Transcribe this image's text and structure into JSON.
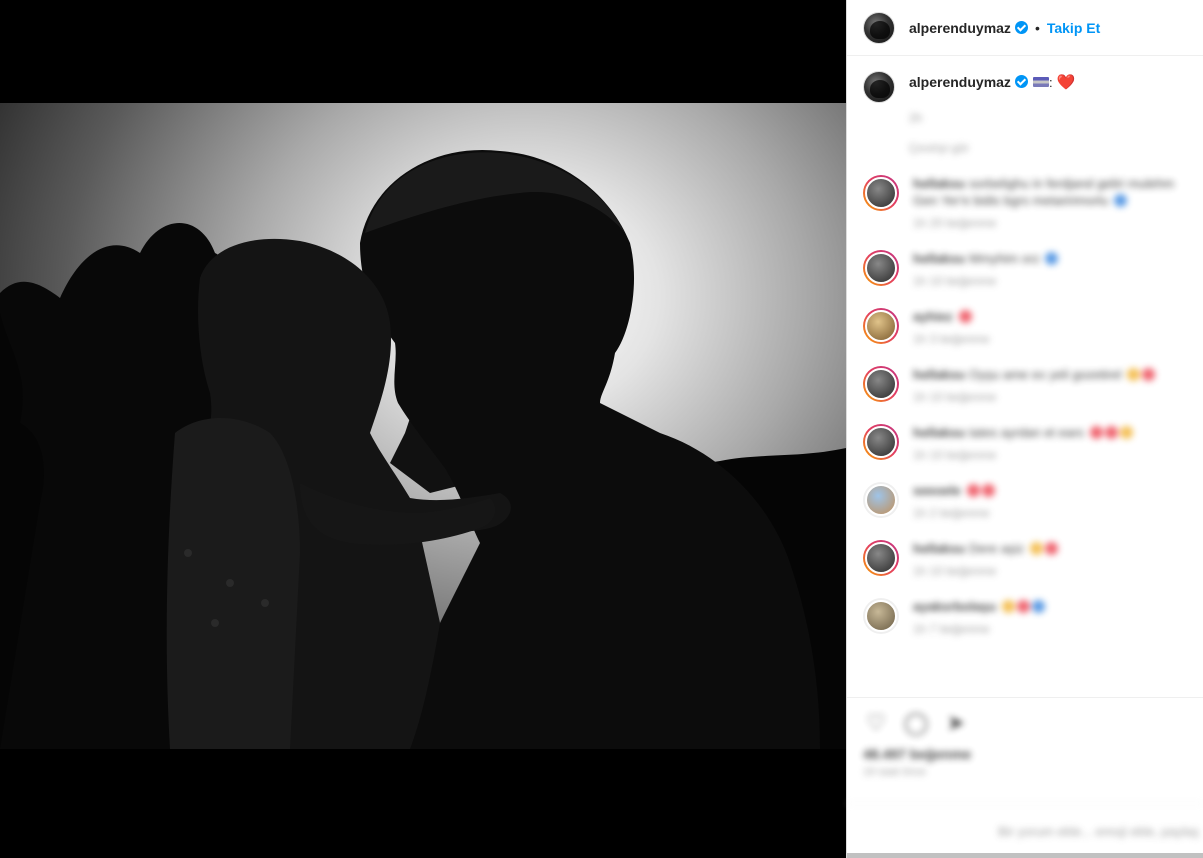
{
  "post": {
    "username": "alperenduymaz",
    "follow_label": "Takip Et",
    "separator": "•"
  },
  "caption": {
    "username": "alperenduymaz",
    "text_colon": ":",
    "emoji": "❤️",
    "edited": "2h",
    "see_translation": "Çeviriyi gör"
  },
  "comments": [
    {
      "user": "hellaksu",
      "text": "sorbelighu in ferdjand geliri mulehm Gen Yer'e bidis bgrs metaririmorlu",
      "meta": "1h   20 beğenme"
    },
    {
      "user": "hellaksu",
      "text": "Mmyhim orz",
      "meta": "1h   10 beğenme"
    },
    {
      "user": "ayhiez",
      "text": "",
      "meta": "1h   3 beğenme"
    },
    {
      "user": "hellaksu",
      "text": "Oyşu ame ex yeli gozetirel",
      "meta": "1h   10 beğenme"
    },
    {
      "user": "hellaksu",
      "text": "tates ayrdan et ears",
      "meta": "1h   10 beğenme"
    },
    {
      "user": "seeoele",
      "text": "",
      "meta": "1h   2 beğenme"
    },
    {
      "user": "hellaksu",
      "text": "Dere aşiz",
      "meta": "1h   10 beğenme"
    },
    {
      "user": "ayaksrbolaşu",
      "text": "",
      "meta": "1h   7 beğenme"
    }
  ],
  "actions": {
    "likes": "48.497 beğenme",
    "time": "19 saat önce",
    "add_comment_placeholder": "Bir yorum ekle... emoji ekle, paylaş"
  },
  "icons": {
    "like": "heart-outline-icon",
    "comment": "comment-icon",
    "share": "share-icon"
  },
  "colors": {
    "accent": "#0095f6",
    "heart": "#ed4956"
  }
}
